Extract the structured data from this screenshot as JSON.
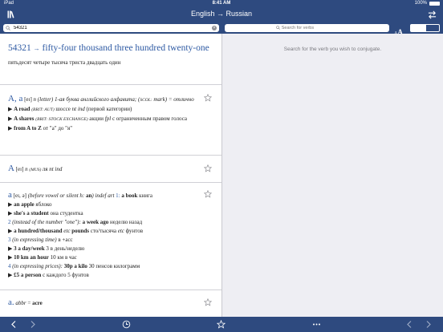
{
  "status": {
    "carrier": "iPad",
    "time": "8:41 AM",
    "battery": "100%"
  },
  "nav": {
    "title": "English → Russian"
  },
  "search": {
    "query": "54321",
    "verb_placeholder": "Search for verbs"
  },
  "number_result": {
    "headline": "fifty-four thousand three hundred twenty-one",
    "number": "54321",
    "arrow": "→",
    "translation": "пятьдесят четыре тысяча триста двадцать один"
  },
  "entries": [
    {
      "headword": "A, a",
      "lines": [
        [
          "[eɪ] ",
          "n ",
          "(letter) ",
          "1-ая буква английского алфавита; (",
          "SCOL:",
          " mark) = отлично"
        ],
        [
          "A road",
          "(BRIT: AUT)",
          "шоссе ",
          "nt ind",
          " (первой категории)"
        ],
        [
          "A shares",
          "(BRIT: STOCK EXCHANGE)",
          "акции ",
          "fpl",
          " с ограниченным правом голоса"
        ],
        [
          "from A to Z",
          "от \"а\" до \"я\""
        ]
      ]
    },
    {
      "headword": "A",
      "lines": [
        [
          "[eɪ] ",
          "n ",
          "(MUS) ",
          "ля ",
          "nt ind"
        ]
      ]
    },
    {
      "headword": "a",
      "lines": [
        [
          "[eɪ, ə] ",
          "(before vowel or silent h: ",
          "an",
          ") ",
          "indef art ",
          "1: ",
          "a book",
          " книга"
        ],
        [
          "an apple",
          "яблоко"
        ],
        [
          "she's a student",
          "она студентка"
        ],
        [
          "2",
          " (instead of the number \"one\"): ",
          "a week ago",
          " неделю назад"
        ],
        [
          "a hundred/thousand ",
          "etc",
          " pounds",
          " сто/тысяча ",
          "etc",
          " фунтов"
        ],
        [
          "3",
          " (in expressing time) ",
          "в +acc"
        ],
        [
          "3 a day/week",
          "3 в день/неделю"
        ],
        [
          "10 km an hour",
          "10 км в час"
        ],
        [
          "4",
          " (in expressing prices): ",
          "30p a kilo",
          " 30 пенсов килограмм"
        ],
        [
          "£5 a person",
          "с каждого 5 фунтов"
        ]
      ]
    },
    {
      "headword": "a.",
      "lines": [
        [
          "abbr",
          " = ",
          "acre"
        ]
      ]
    }
  ],
  "conjugation": {
    "hint": "Search for the verb you wish to conjugate."
  },
  "icons": [
    "library-icon",
    "swap-languages-icon",
    "search-icon",
    "clear-icon",
    "text-size-icon",
    "single-pane-icon",
    "split-pane-icon",
    "favorite-star-icon",
    "back-icon",
    "forward-icon",
    "history-icon",
    "favorites-icon",
    "more-icon"
  ],
  "colors": {
    "bar": "#2e4a7f",
    "link": "#2e5aa3",
    "pane_bg": "#eeeef3"
  }
}
